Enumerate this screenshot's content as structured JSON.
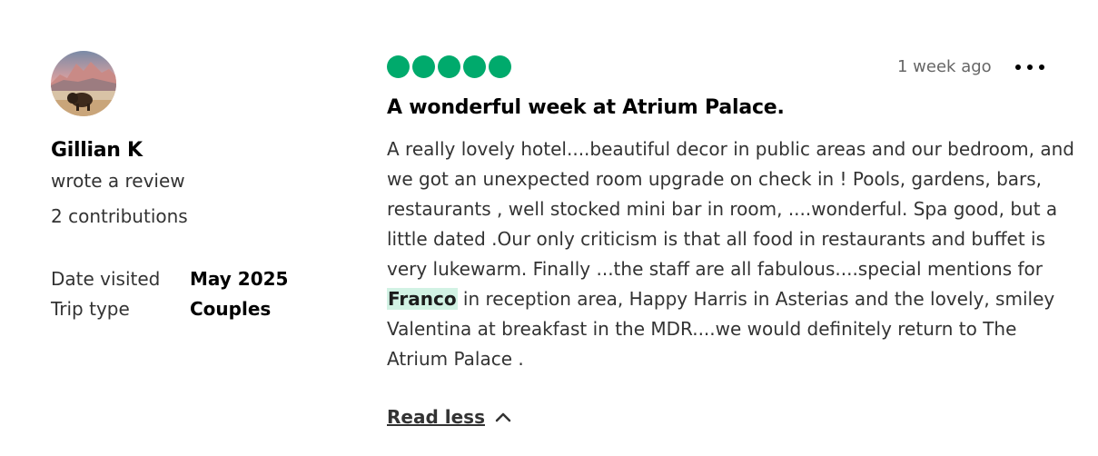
{
  "reviewer": {
    "avatar_icon": "avatar-bison-landscape",
    "name": "Gillian K",
    "action": "wrote a review",
    "contributions": "2 contributions",
    "date_visited_label": "Date visited",
    "date_visited_value": "May 2025",
    "trip_type_label": "Trip type",
    "trip_type_value": "Couples"
  },
  "review": {
    "rating": 5,
    "rating_max": 5,
    "rating_color": "#00AA6C",
    "timestamp": "1 week ago",
    "more_icon": "more-options-icon",
    "title": "A wonderful week at Atrium Palace.",
    "body_part1": "A really lovely hotel....beautiful decor in public areas and our bedroom, and we got an unexpected room upgrade on check in ! Pools, gardens, bars, restaurants , well stocked mini bar in room, ....wonderful. Spa good, but a little dated .Our only criticism is that all food in restaurants and buffet is very lukewarm. Finally ...the staff are all fabulous....special mentions for ",
    "highlight": "Franco",
    "body_part2": " in reception area, Happy Harris in Asterias and the lovely, smiley Valentina at breakfast in the MDR....we would definitely return to The Atrium Palace .",
    "read_less": "Read less",
    "highlight_color": "#D2F2E4"
  }
}
